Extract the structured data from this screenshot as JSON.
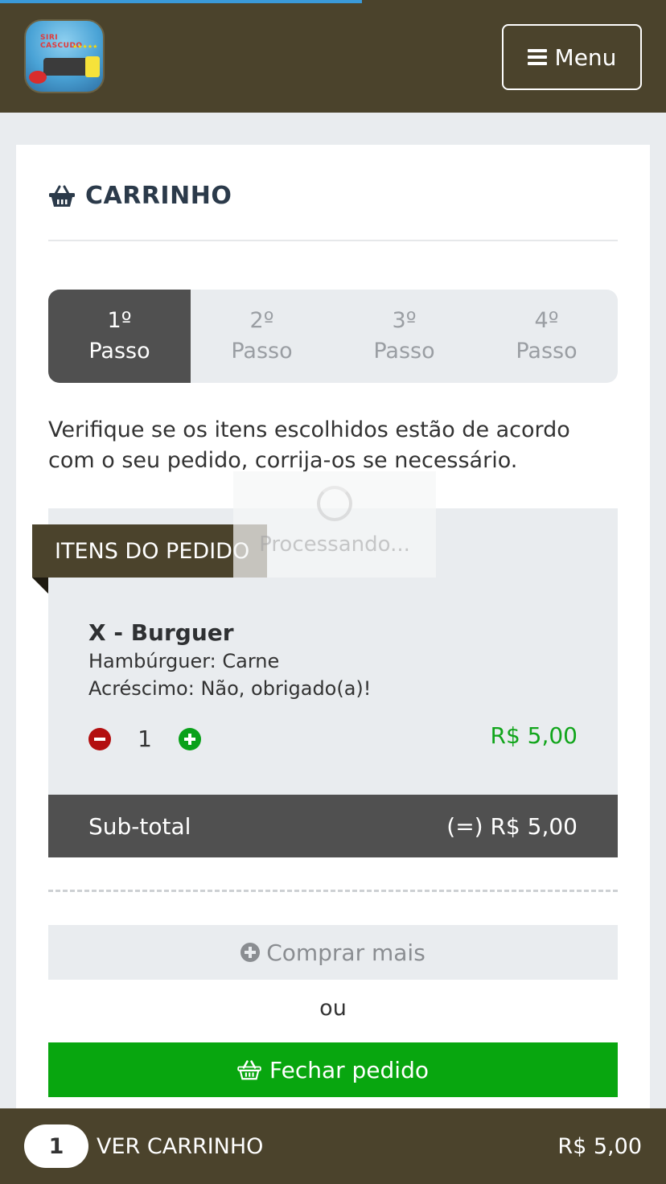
{
  "header": {
    "logo_text": "SIRI CASCUDO",
    "logo_stars": "★★★★★",
    "menu_label": "Menu"
  },
  "page": {
    "title": "CARRINHO",
    "instructions": "Verifique se os itens escolhidos estão de acordo com o seu pedido, corrija-os se necessário."
  },
  "steps": [
    {
      "number": "1º",
      "label": "Passo",
      "active": true
    },
    {
      "number": "2º",
      "label": "Passo",
      "active": false
    },
    {
      "number": "3º",
      "label": "Passo",
      "active": false
    },
    {
      "number": "4º",
      "label": "Passo",
      "active": false
    }
  ],
  "order": {
    "section_label": "ITENS DO PEDIDO",
    "items": [
      {
        "name": "X - Burguer",
        "options": [
          "Hambúrguer: Carne",
          "Acréscimo: Não, obrigado(a)!"
        ],
        "quantity": "1",
        "price": "R$ 5,00"
      }
    ],
    "subtotal_label": "Sub-total",
    "subtotal_value": "(=) R$ 5,00"
  },
  "actions": {
    "buy_more_label": "Comprar mais",
    "or_label": "ou",
    "close_order_label": "Fechar pedido"
  },
  "loading": {
    "text": "Processando..."
  },
  "bottom_bar": {
    "count": "1",
    "label": "VER CARRINHO",
    "total": "R$ 5,00"
  },
  "colors": {
    "header_bg": "#4b432c",
    "accent_green": "#08a60f",
    "minus_red": "#b30f10",
    "active_step": "#505050"
  }
}
